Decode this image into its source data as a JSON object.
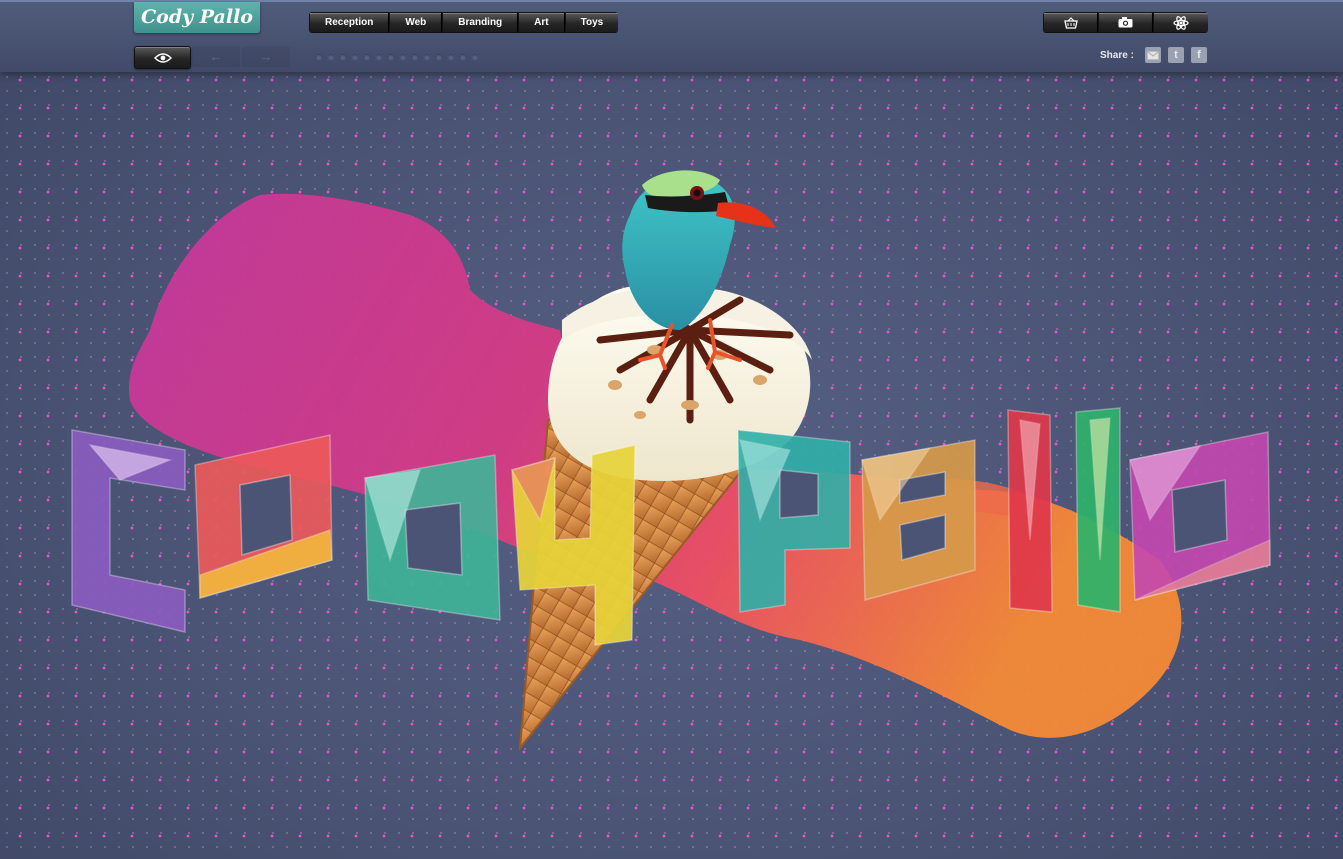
{
  "site": {
    "logo_text": "Cody Pallo"
  },
  "nav": {
    "items": [
      {
        "label": "Reception"
      },
      {
        "label": "Web"
      },
      {
        "label": "Branding"
      },
      {
        "label": "Art"
      },
      {
        "label": "Toys"
      }
    ]
  },
  "toolbar": {
    "icons": [
      "basket-icon",
      "camera-icon",
      "atom-icon"
    ],
    "view_icon": "eye-icon",
    "prev_icon": "arrow-left-icon",
    "next_icon": "arrow-right-icon",
    "pager_dots": 14
  },
  "share": {
    "label": "Share :",
    "icons": [
      "email-icon",
      "twitter-icon",
      "facebook-icon"
    ],
    "twitter_glyph": "t",
    "facebook_glyph": "f"
  },
  "artwork": {
    "lettering": "CodyPallo",
    "colors": {
      "magenta": "#c0369a",
      "orange": "#f0773a",
      "teal": "#3ab2a8",
      "cone": "#d8914a"
    }
  }
}
